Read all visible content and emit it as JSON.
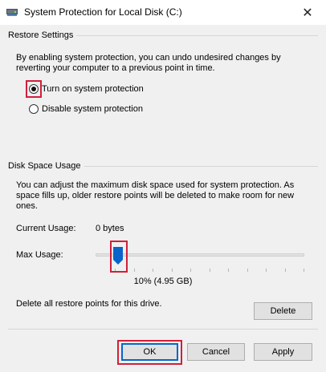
{
  "window": {
    "title": "System Protection for Local Disk (C:)",
    "icon": "drive-icon",
    "close_glyph": "✕"
  },
  "restore_settings": {
    "heading": "Restore Settings",
    "description": "By enabling system protection, you can undo undesired changes by reverting your computer to a previous point in time.",
    "options": [
      {
        "label": "Turn on system protection",
        "selected": true
      },
      {
        "label": "Disable system protection",
        "selected": false
      }
    ]
  },
  "disk_space": {
    "heading": "Disk Space Usage",
    "description": "You can adjust the maximum disk space used for system protection. As space fills up, older restore points will be deleted to make room for new ones.",
    "current_usage_label": "Current Usage:",
    "current_usage_value": "0 bytes",
    "max_usage_label": "Max Usage:",
    "max_usage_fraction": 0.1,
    "max_usage_display": "10% (4.95 GB)",
    "delete_text": "Delete all restore points for this drive.",
    "delete_button": "Delete"
  },
  "footer": {
    "ok": "OK",
    "cancel": "Cancel",
    "apply": "Apply"
  },
  "colors": {
    "accent": "#0a64c9",
    "highlight": "#d0203a",
    "background": "#f0f0f0"
  }
}
